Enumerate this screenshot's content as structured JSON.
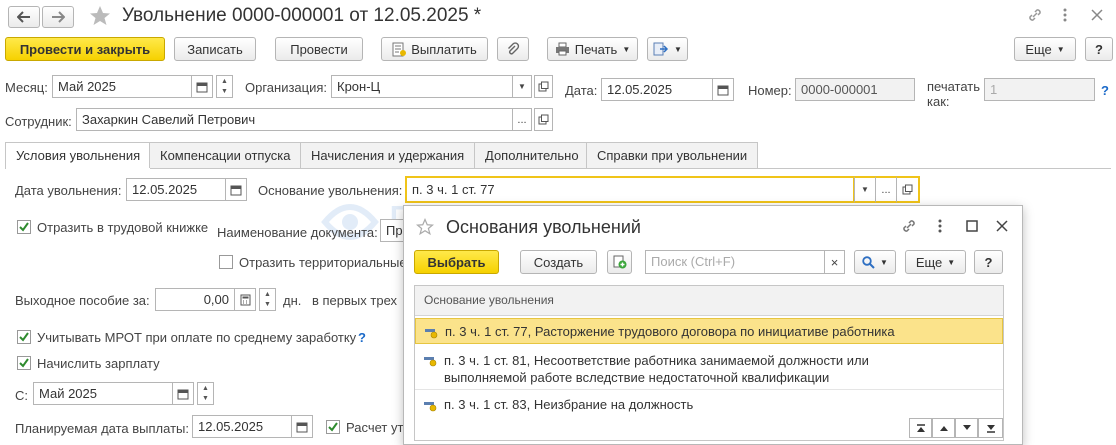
{
  "window": {
    "title": "Увольнение 0000-000001 от 12.05.2025 *"
  },
  "toolbar": {
    "post_close": "Провести и закрыть",
    "save": "Записать",
    "post": "Провести",
    "pay": "Выплатить",
    "print": "Печать",
    "more": "Еще",
    "help": "?"
  },
  "header": {
    "month_label": "Месяц:",
    "month_value": "Май 2025",
    "org_label": "Организация:",
    "org_value": "Крон-Ц",
    "date_label": "Дата:",
    "date_value": "12.05.2025",
    "number_label": "Номер:",
    "number_value": "0000-000001",
    "print_as_label": "печатать как:",
    "print_as_value": "1",
    "employee_label": "Сотрудник:",
    "employee_value": "Захаркин Савелий Петрович",
    "help": "?"
  },
  "tabs": [
    "Условия увольнения",
    "Компенсации отпуска",
    "Начисления и удержания",
    "Дополнительно",
    "Справки при увольнении"
  ],
  "conditions": {
    "dismissal_date_label": "Дата увольнения:",
    "dismissal_date_value": "12.05.2025",
    "basis_label": "Основание увольнения:",
    "basis_value": "п. 3 ч. 1 ст. 77",
    "workbook_label": "Отразить в трудовой книжке",
    "doc_name_label": "Наименование документа:",
    "doc_name_value": "Пр",
    "territorial_label": "Отразить территориальные",
    "severance_label": "Выходное пособие за:",
    "severance_value": "0,00",
    "severance_unit": "дн.",
    "first_three_label": "в первых трех",
    "mrot_label": "Учитывать МРОТ при оплате по среднему заработку",
    "mrot_help": "?",
    "accrue_label": "Начислить зарплату",
    "from_label": "С:",
    "from_value": "Май 2025",
    "pay_date_label": "Планируемая дата выплаты:",
    "pay_date_value": "12.05.2025",
    "calc_label": "Расчет ут"
  },
  "watermark": "БухЭксперт",
  "popup": {
    "title": "Основания увольнений",
    "select": "Выбрать",
    "create": "Создать",
    "search_placeholder": "Поиск (Ctrl+F)",
    "more": "Еще",
    "help": "?",
    "column_header": "Основание увольнения",
    "rows": [
      "п. 3 ч. 1 ст. 77, Расторжение трудового договора по инициативе работника",
      "п. 3 ч. 1 ст. 81, Несоответствие работника занимаемой должности или выполняемой работе вследствие недостаточной квалификации",
      "п. 3 ч. 1 ст. 83, Неизбрание на должность"
    ]
  },
  "colors": {
    "accent_yellow": "#f6d100",
    "selected_row": "#fbe38b",
    "link_blue": "#1b6ac9"
  }
}
